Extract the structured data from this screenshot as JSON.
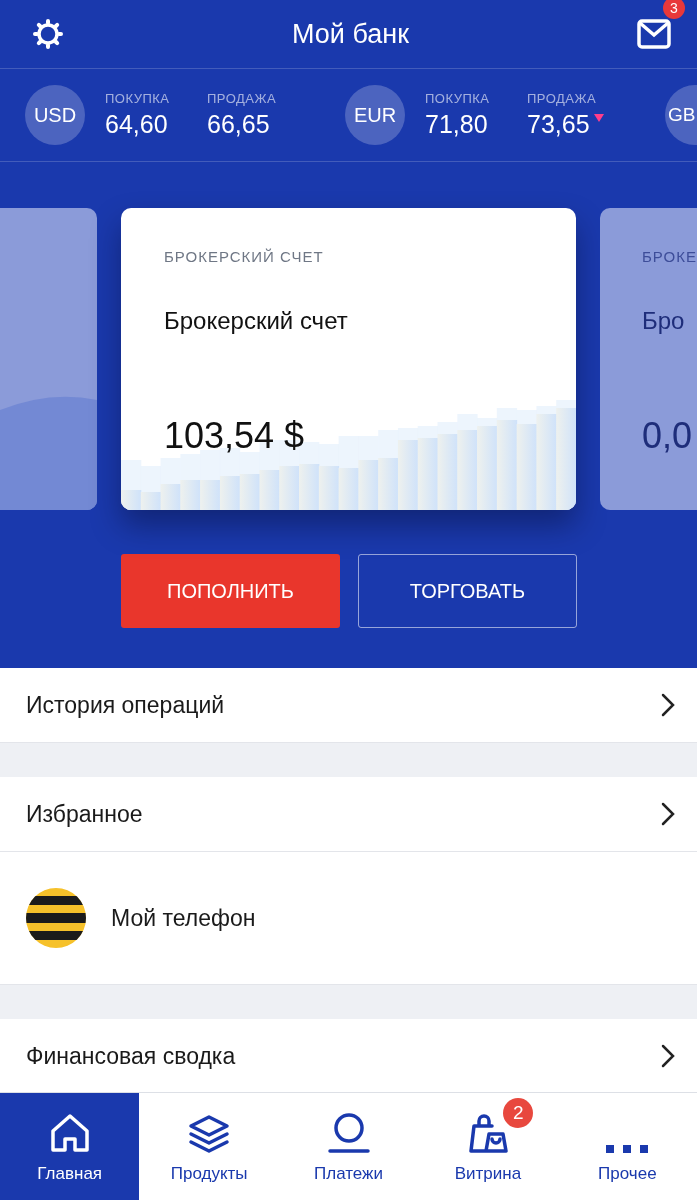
{
  "header": {
    "title": "Мой банк",
    "mail_badge": "3"
  },
  "rates": [
    {
      "currency": "USD",
      "buy_label": "ПОКУПКА",
      "buy": "64,60",
      "sell_label": "ПРОДАЖА",
      "sell": "66,65",
      "falling": false
    },
    {
      "currency": "EUR",
      "buy_label": "ПОКУПКА",
      "buy": "71,80",
      "sell_label": "ПРОДАЖА",
      "sell": "73,65",
      "falling": true
    },
    {
      "currency": "GB"
    }
  ],
  "accounts": [
    {
      "kind": "previous"
    },
    {
      "kind": "current",
      "label": "БРОКЕРСКИЙ СЧЕТ",
      "title": "Брокерский счет",
      "amount": "103,54 $"
    },
    {
      "kind": "next",
      "label": "БРОКЕ",
      "title": "Бро",
      "amount": "0,0"
    }
  ],
  "actions": [
    {
      "label": "ПОПОЛНИТЬ",
      "kind": "primary"
    },
    {
      "label": "ТОРГОВАТЬ",
      "kind": "outline"
    }
  ],
  "menu_sections": [
    {
      "items": [
        {
          "label": "История операций",
          "kind": "link"
        }
      ]
    },
    {
      "items": [
        {
          "label": "Избранное",
          "kind": "link"
        },
        {
          "label": "Мой телефон",
          "kind": "phone"
        }
      ]
    },
    {
      "items": [
        {
          "label": "Финансовая сводка",
          "kind": "link"
        }
      ]
    }
  ],
  "tabs": [
    {
      "label": "Главная",
      "kind": "home",
      "selected": true
    },
    {
      "label": "Продукты",
      "kind": "layers",
      "selected": false
    },
    {
      "label": "Платежи",
      "kind": "payments",
      "selected": false
    },
    {
      "label": "Витрина",
      "kind": "bags",
      "selected": false,
      "badge": "2"
    },
    {
      "label": "Прочее",
      "kind": "more",
      "selected": false
    }
  ]
}
